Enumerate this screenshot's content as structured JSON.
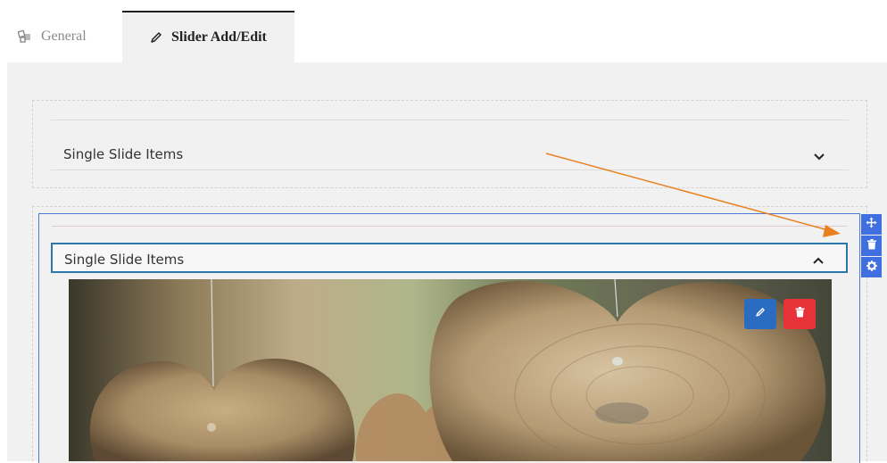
{
  "tabs": [
    {
      "label": "General",
      "icon": "cubes-icon",
      "active": false
    },
    {
      "label": "Slider Add/Edit",
      "icon": "pencil-icon",
      "active": true
    }
  ],
  "sections": {
    "collapsed": {
      "title": "Single Slide Items",
      "chevron": "chevron-down-icon"
    },
    "expanded": {
      "title": "Single Slide Items",
      "chevron": "chevron-up-icon"
    }
  },
  "slide_actions": {
    "edit_icon": "pencil-icon",
    "delete_icon": "trash-icon"
  },
  "widget_tools": [
    "move-icon",
    "trash-icon",
    "gear-icon"
  ],
  "colors": {
    "accent_blue": "#3f6fe0",
    "toggle_border": "#2c77a8",
    "edit_button": "#2a6cc2",
    "delete_button": "#e8323a",
    "annotation_arrow": "#e8801e"
  }
}
